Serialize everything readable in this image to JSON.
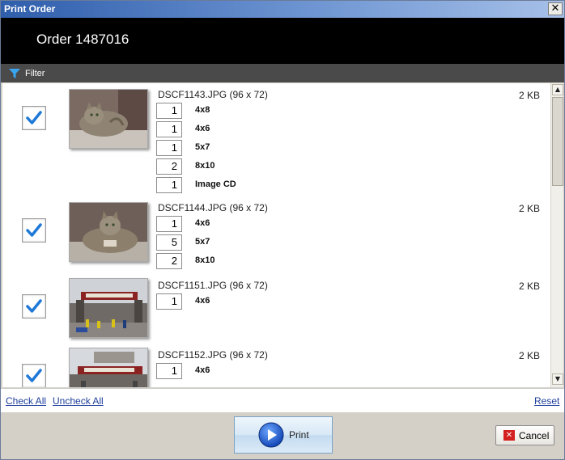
{
  "window": {
    "title": "Print Order",
    "close_glyph": "✕"
  },
  "header": {
    "order_title": "Order 1487016"
  },
  "filter": {
    "label": "Filter",
    "icon": "funnel-icon"
  },
  "items": [
    {
      "filename": "DSCF1143.JPG (96 x 72)",
      "size": "2 KB",
      "checked": true,
      "image": "cat-on-couch",
      "quantities": [
        {
          "qty": "1",
          "label": "4x8"
        },
        {
          "qty": "1",
          "label": "4x6"
        },
        {
          "qty": "1",
          "label": "5x7"
        },
        {
          "qty": "2",
          "label": "8x10"
        },
        {
          "qty": "1",
          "label": "Image CD"
        }
      ]
    },
    {
      "filename": "DSCF1144.JPG (96 x 72)",
      "size": "2 KB",
      "checked": true,
      "image": "cat-on-couch",
      "quantities": [
        {
          "qty": "1",
          "label": "4x6"
        },
        {
          "qty": "5",
          "label": "5x7"
        },
        {
          "qty": "2",
          "label": "8x10"
        }
      ]
    },
    {
      "filename": "DSCF1151.JPG (96 x 72)",
      "size": "2 KB",
      "checked": true,
      "image": "nationals-park-entrance",
      "quantities": [
        {
          "qty": "1",
          "label": "4x6"
        }
      ]
    },
    {
      "filename": "DSCF1152.JPG (96 x 72)",
      "size": "2 KB",
      "checked": true,
      "image": "nationals-park-entrance",
      "quantities": [
        {
          "qty": "1",
          "label": "4x6"
        }
      ]
    }
  ],
  "links": {
    "check_all": "Check All",
    "uncheck_all": "Uncheck All",
    "reset": "Reset"
  },
  "buttons": {
    "print": "Print",
    "cancel": "Cancel"
  },
  "scrollbar": {
    "up": "▲",
    "down": "▼"
  },
  "colors": {
    "accent": "#1e78d7",
    "header_bg": "#000000",
    "filter_bg": "#4a4a4a",
    "link": "#1f3f9c"
  }
}
